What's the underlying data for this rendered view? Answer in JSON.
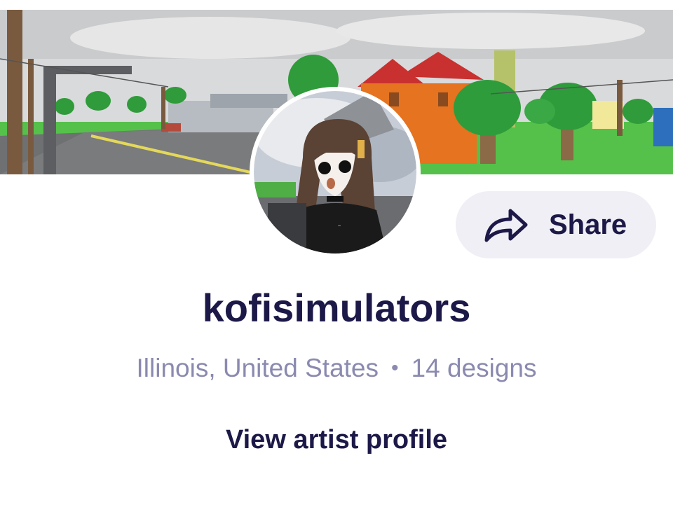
{
  "profile": {
    "username": "kofisimulators",
    "location": "Illinois, United States",
    "separator": "•",
    "designs": "14 designs"
  },
  "actions": {
    "share_label": "Share",
    "share_icon": "share-arrow-icon",
    "view_profile_label": "View artist profile"
  },
  "colors": {
    "primary_text": "#1c1948",
    "secondary_text": "#8a8ab0",
    "button_bg": "#f0eff5"
  }
}
